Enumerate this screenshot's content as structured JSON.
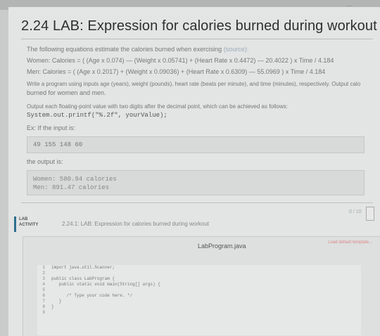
{
  "header": {
    "title": "2.24 LAB: Expression for calories burned during workout"
  },
  "description": {
    "intro": "The following equations estimate the calories burned when exercising",
    "source_link": "(source):",
    "women_eq": "Women: Calories = ( (Age x 0.074) — (Weight x 0.05741) + (Heart Rate x 0.4472) — 20.4022 ) x Time / 4.184",
    "men_eq": "Men: Calories = ( (Age x 0.2017) + (Weight x 0.09036) + (Heart Rate x 0.6309) — 55.0969 ) x Time / 4.184",
    "task_line1": "Write a program using inputs age (years), weight (pounds), heart rate (beats per minute), and time (minutes), respectively. Output calo",
    "task_line2": "burned for women and men.",
    "output_line": "Output each floating-point value with two digits after the decimal point, which can be achieved as follows:",
    "code_example": "System.out.printf(\"%.2f\", yourValue);",
    "example_intro": "Ex: If the input is:",
    "input_sample": "49 155 148 60",
    "output_intro": "the output is:",
    "output_women": "Women: 580.94 calories",
    "output_men": "Men: 891.47 calories"
  },
  "activity": {
    "badge_line1": "LAB",
    "badge_line2": "ACTIVITY",
    "title": "2.24.1: LAB: Expression for calories burned during workout",
    "score": "0 / 10"
  },
  "editor": {
    "filename": "LabProgram.java",
    "load_template": "Load default template...",
    "line_numbers": "1\n2\n3\n4\n5\n6\n7\n8\n9",
    "code": "import java.util.Scanner;\n\npublic class LabProgram {\n   public static void main(String[] args) {\n\n      /* Type your code here. */\n   }\n}\n"
  }
}
